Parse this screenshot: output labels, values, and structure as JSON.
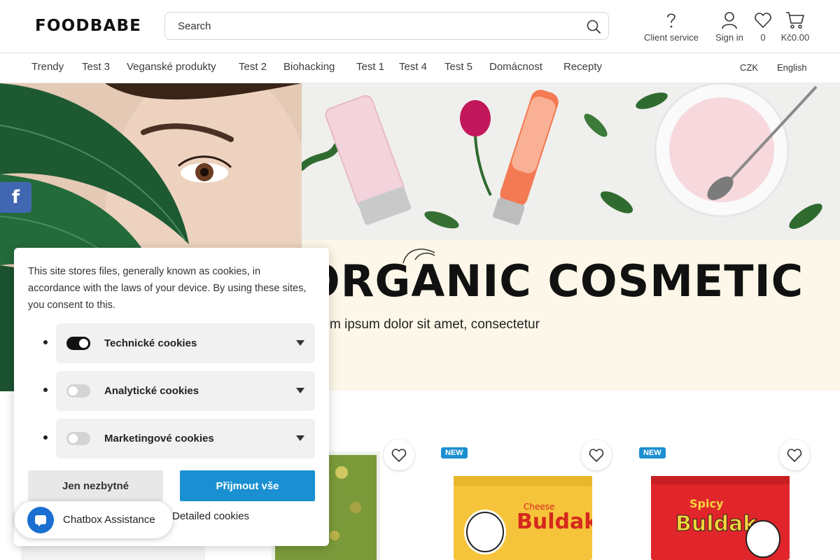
{
  "header": {
    "logo": "FOODBABE",
    "search_placeholder": "Search",
    "client_service": "Client service",
    "sign_in": "Sign in",
    "wishlist_count": "0",
    "cart_total": "Kč0.00"
  },
  "nav": {
    "items": [
      "Trendy",
      "Test 3",
      "Veganské produkty",
      "Test 2",
      "Biohacking",
      "Test 1",
      "Test 4",
      "Test 5",
      "Domácnost",
      "Recepty"
    ],
    "currency": "CZK",
    "language": "English"
  },
  "hero": {
    "title": "ORGANIC COSMETIC",
    "subtitle": "Lorem ipsum dolor sit amet, consectetur"
  },
  "products": {
    "badge": "NEW"
  },
  "cookie": {
    "text": "This site stores files, generally known as cookies, in accordance with the laws of your device. By using these sites, you consent to this.",
    "options": [
      {
        "label": "Technické cookies",
        "enabled": true
      },
      {
        "label": "Analytické cookies",
        "enabled": false
      },
      {
        "label": "Marketingové cookies",
        "enabled": false
      }
    ],
    "necessary_button": "Jen nezbytné",
    "accept_button": "Přijmout vše",
    "detailed_link": "Detailed cookies"
  },
  "chat": {
    "label": "Chatbox Assistance"
  },
  "colors": {
    "accent": "#1a8fd1",
    "facebook": "#4267b2",
    "hero_panel": "#fcf7e8"
  }
}
